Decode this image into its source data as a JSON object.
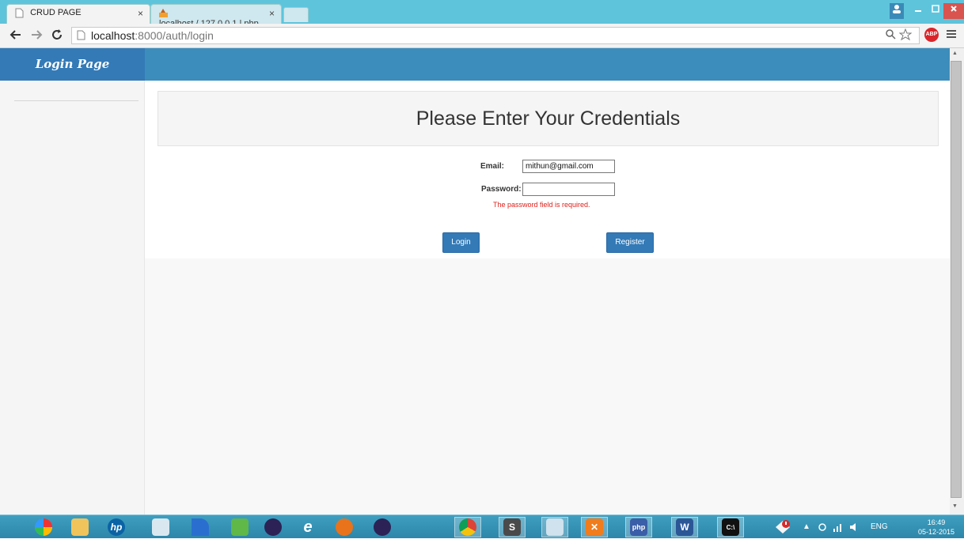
{
  "browser": {
    "tabs": [
      {
        "title": "CRUD PAGE",
        "active": true
      },
      {
        "title": "localhost / 127.0.0.1 | php",
        "active": false
      }
    ],
    "tab_close_glyph": "×",
    "url_host": "localhost",
    "url_path": ":8000/auth/login",
    "icons": [
      "back-arrow-icon",
      "forward-arrow-icon",
      "reload-icon",
      "page-icon",
      "zoom-icon",
      "star-icon",
      "adblock-icon",
      "menu-icon"
    ],
    "adblock_label": "ABP"
  },
  "sidebar": {
    "title": "Login Page"
  },
  "main": {
    "heading": "Please Enter Your Credentials",
    "email_label": "Email:",
    "email_value": "mithun@gmail.com",
    "password_label": "Password:",
    "password_value": "",
    "password_error": "The password field is required.",
    "login_label": "Login",
    "register_label": "Register"
  },
  "colors": {
    "header_dark": "#337ab7",
    "header": "#3c8dbc",
    "error": "#e0201b",
    "tabbar": "#5ec4dc"
  },
  "taskbar": {
    "apps": [
      "picasa",
      "file-explorer",
      "hp",
      "paint",
      "dreamweaver",
      "media-player",
      "eclipse",
      "internet-explorer",
      "firefox",
      "eclipse-2",
      "chrome",
      "sublime-text",
      "photos",
      "xampp",
      "php-designer",
      "word",
      "cmd"
    ],
    "tray_lang": "ENG",
    "time": "16:49",
    "date": "05-12-2015"
  }
}
